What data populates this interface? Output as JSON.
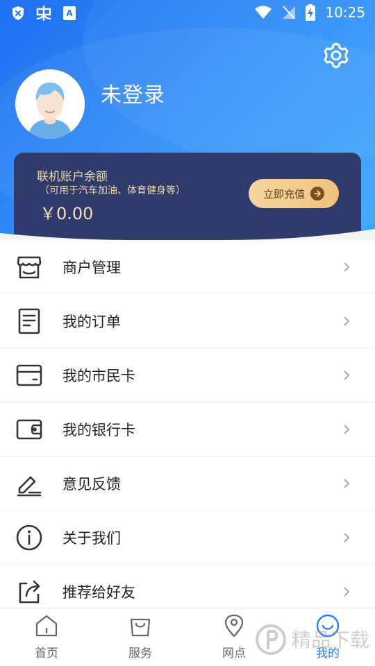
{
  "status_bar": {
    "time": "10:25",
    "icons": [
      "shield-x-icon",
      "bug-icon",
      "a-icon",
      "wifi-icon",
      "no-signal-icon",
      "battery-charging-icon"
    ]
  },
  "header": {
    "settings_icon": "gear-icon",
    "user_name": "未登录",
    "gradient": [
      "#1f6ff0",
      "#3aa8fb"
    ]
  },
  "balance_card": {
    "title": "联机账户余额",
    "subtitle": "（可用于汽车加油、体育健身等）",
    "amount": "￥0.00",
    "recharge_label": "立即充值",
    "bg_color": "#2f3b6b",
    "accent_color": "#f1c27c"
  },
  "menu": {
    "items": [
      {
        "label": "商户管理",
        "icon": "store-icon"
      },
      {
        "label": "我的订单",
        "icon": "order-document-icon"
      },
      {
        "label": "我的市民卡",
        "icon": "card-icon"
      },
      {
        "label": "我的银行卡",
        "icon": "wallet-icon"
      },
      {
        "label": "意见反馈",
        "icon": "edit-feedback-icon"
      },
      {
        "label": "关于我们",
        "icon": "info-icon"
      },
      {
        "label": "推荐给好友",
        "icon": "share-icon"
      }
    ]
  },
  "tabbar": {
    "tabs": [
      {
        "label": "首页",
        "icon": "home-icon"
      },
      {
        "label": "服务",
        "icon": "shopping-bag-icon"
      },
      {
        "label": "网点",
        "icon": "location-pin-icon"
      },
      {
        "label": "我的",
        "icon": "smile-icon",
        "active": true
      }
    ],
    "active_color": "#2a7df5"
  },
  "watermark": {
    "text": "精品下载"
  }
}
